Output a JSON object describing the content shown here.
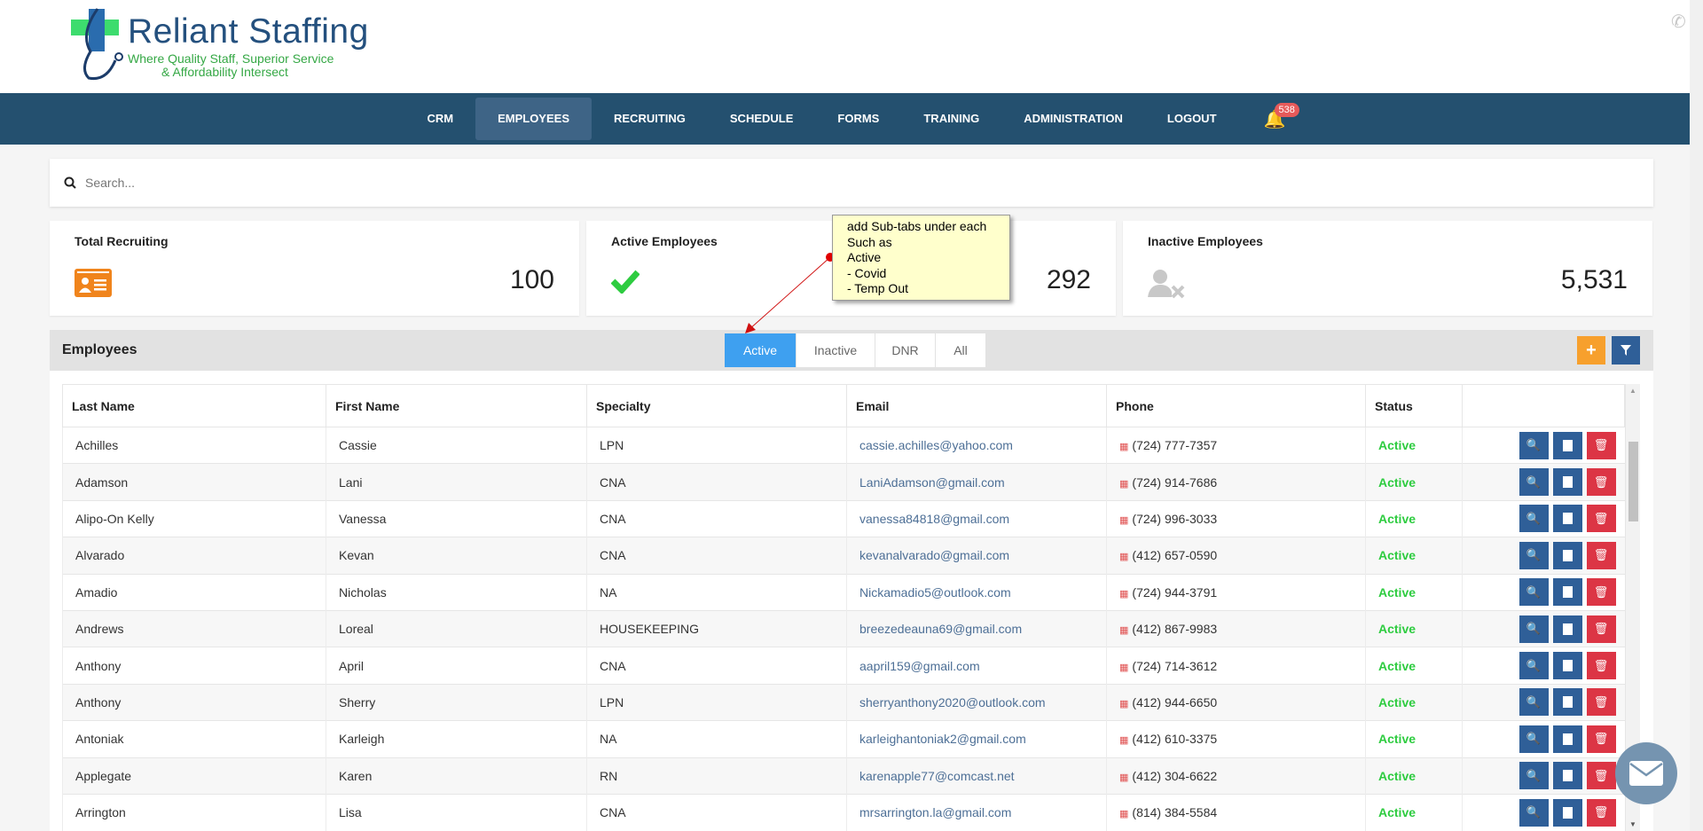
{
  "brand": {
    "name": "Reliant Staffing",
    "tagline_1": "Where Quality Staff, Superior Service",
    "tagline_2": "& Affordability Intersect"
  },
  "nav": {
    "items": [
      "CRM",
      "EMPLOYEES",
      "RECRUITING",
      "SCHEDULE",
      "FORMS",
      "TRAINING",
      "ADMINISTRATION",
      "LOGOUT"
    ],
    "active": "EMPLOYEES",
    "notification_count": "538"
  },
  "search": {
    "placeholder": "Search..."
  },
  "cards": [
    {
      "label": "Total Recruiting",
      "value": "100",
      "icon": "id-card-icon",
      "color": "#f0841c"
    },
    {
      "label": "Active Employees",
      "value": "292",
      "icon": "check-icon",
      "color": "#2ecc40"
    },
    {
      "label": "Inactive Employees",
      "value": "5,531",
      "icon": "user-times-icon",
      "color": "#c8c8c8"
    }
  ],
  "panel": {
    "title": "Employees",
    "tabs": [
      "Active",
      "Inactive",
      "DNR",
      "All"
    ],
    "active_tab": "Active",
    "add_label": "+"
  },
  "table": {
    "headers": [
      "Last Name",
      "First Name",
      "Specialty",
      "Email",
      "Phone",
      "Status"
    ],
    "rows": [
      [
        "Achilles",
        "Cassie",
        "LPN",
        "cassie.achilles@yahoo.com",
        "(724) 777-7357",
        "Active"
      ],
      [
        "Adamson",
        "Lani",
        "CNA",
        "LaniAdamson@gmail.com",
        "(724) 914-7686",
        "Active"
      ],
      [
        "Alipo-On Kelly",
        "Vanessa",
        "CNA",
        "vanessa84818@gmail.com",
        "(724) 996-3033",
        "Active"
      ],
      [
        "Alvarado",
        "Kevan",
        "CNA",
        "kevanalvarado@gmail.com",
        "(412) 657-0590",
        "Active"
      ],
      [
        "Amadio",
        "Nicholas",
        "NA",
        "Nickamadio5@outlook.com",
        "(724) 944-3791",
        "Active"
      ],
      [
        "Andrews",
        "Loreal",
        "HOUSEKEEPING",
        "breezedeauna69@gmail.com",
        "(412) 867-9983",
        "Active"
      ],
      [
        "Anthony",
        "April",
        "CNA",
        "aapril159@gmail.com",
        "(724) 714-3612",
        "Active"
      ],
      [
        "Anthony",
        "Sherry",
        "LPN",
        "sherryanthony2020@outlook.com",
        "(412) 944-6650",
        "Active"
      ],
      [
        "Antoniak",
        "Karleigh",
        "NA",
        "karleighantoniak2@gmail.com",
        "(412) 610-3375",
        "Active"
      ],
      [
        "Applegate",
        "Karen",
        "RN",
        "karenapple77@comcast.net",
        "(412) 304-6622",
        "Active"
      ],
      [
        "Arrington",
        "Lisa",
        "CNA",
        "mrsarrington.la@gmail.com",
        "(814) 384-5584",
        "Active"
      ]
    ]
  },
  "annotation": {
    "text": "add Sub-tabs under each\nSuch as\nActive\n- Covid\n- Temp Out"
  }
}
